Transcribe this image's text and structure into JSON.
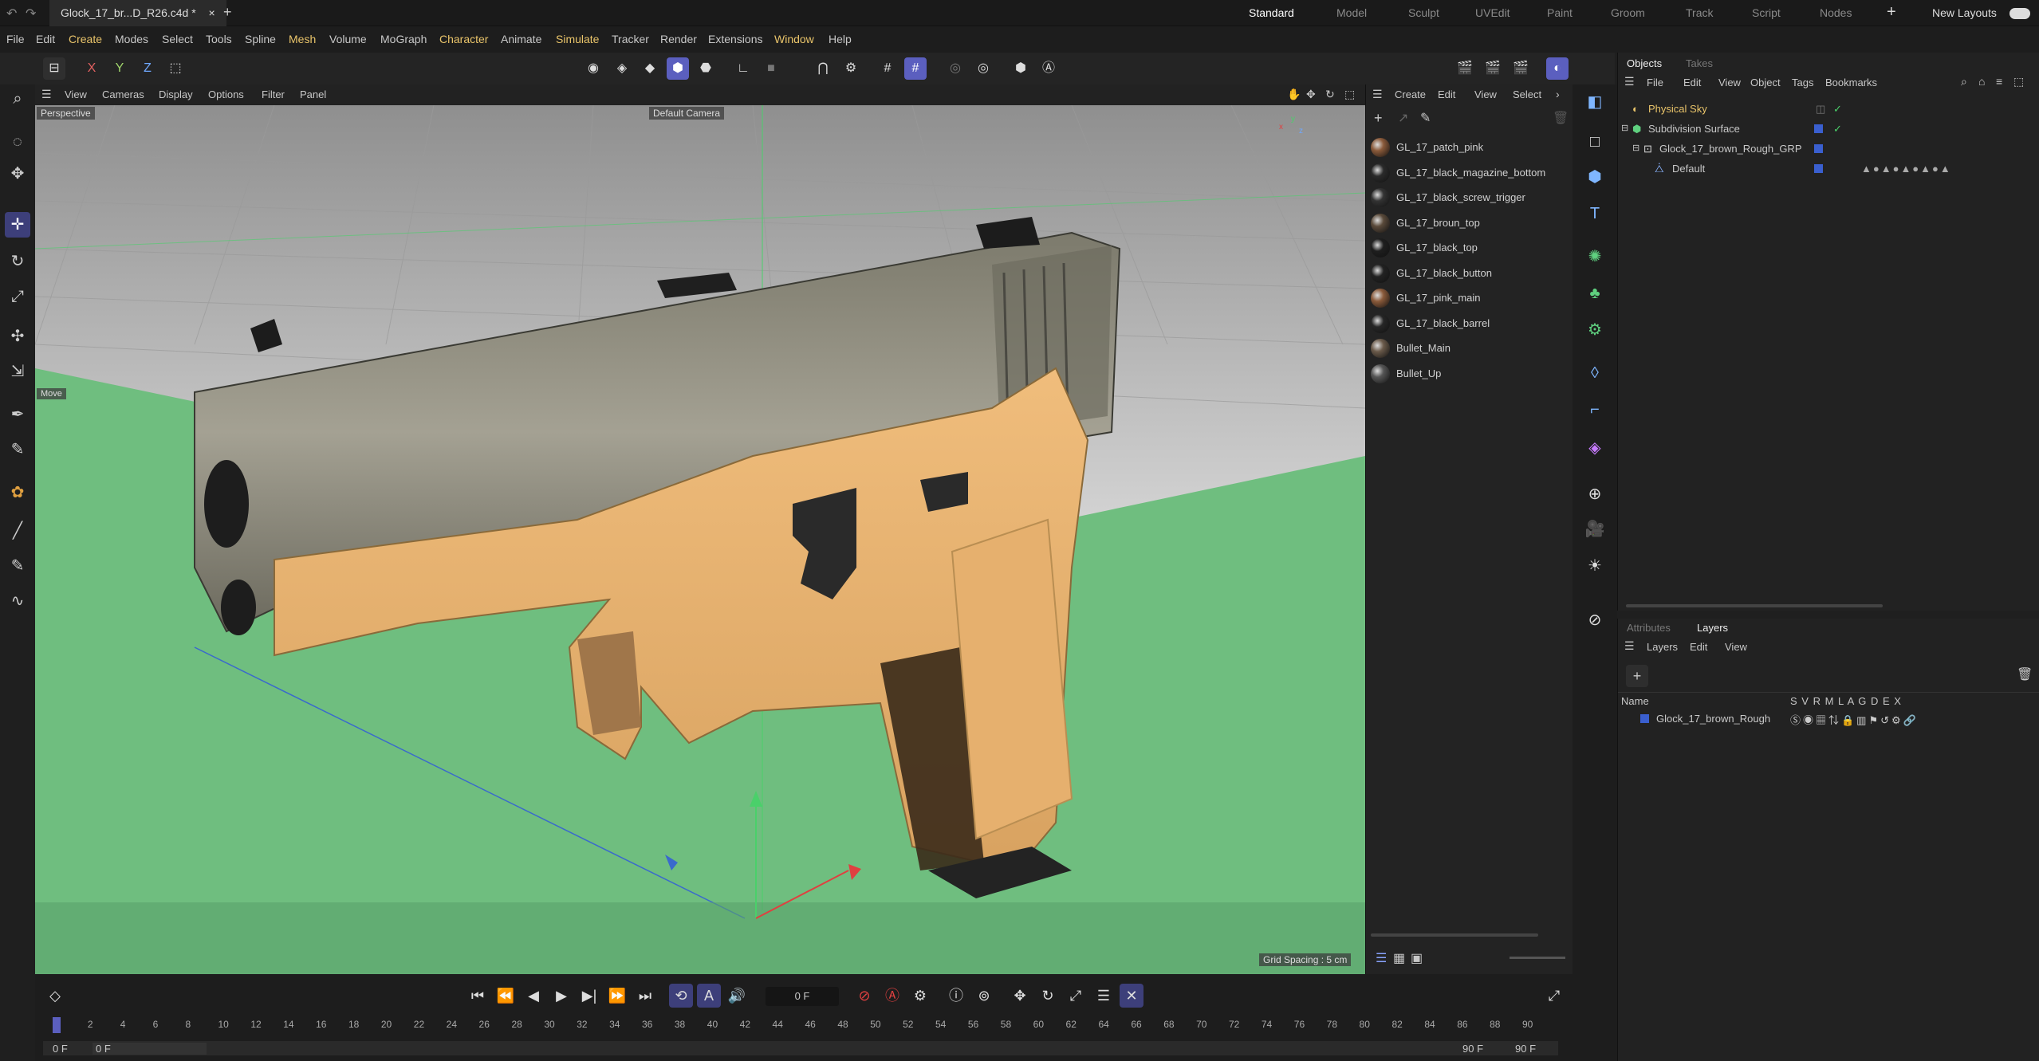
{
  "title": {
    "doc_tab": "Glock_17_br...D_R26.c4d *",
    "close": "×",
    "add": "+",
    "layouts": [
      "Standard",
      "Model",
      "Sculpt",
      "UVEdit",
      "Paint",
      "Groom",
      "Track",
      "Script",
      "Nodes"
    ],
    "new_layouts": "New Layouts"
  },
  "menu": [
    "File",
    "Edit",
    "Create",
    "Modes",
    "Select",
    "Tools",
    "Spline",
    "Mesh",
    "Volume",
    "MoGraph",
    "Character",
    "Animate",
    "Simulate",
    "Tracker",
    "Render",
    "Extensions",
    "Window",
    "Help"
  ],
  "toolbar": {
    "x": "X",
    "y": "Y",
    "z": "Z"
  },
  "viewport": {
    "menu": [
      "View",
      "Cameras",
      "Display",
      "Options",
      "Filter",
      "Panel"
    ],
    "perspective": "Perspective",
    "camera": "Default Camera",
    "move_label": "Move",
    "grid_spacing": "Grid Spacing : 5 cm"
  },
  "materials": {
    "menu": [
      "Create",
      "Edit",
      "View",
      "Select"
    ],
    "items": [
      {
        "name": "GL_17_patch_pink",
        "color": "#8a5a3a"
      },
      {
        "name": "GL_17_black_magazine_bottom",
        "color": "#2a2a2a"
      },
      {
        "name": "GL_17_black_screw_trigger",
        "color": "#333333"
      },
      {
        "name": "GL_17_broun_top",
        "color": "#5a4a3a"
      },
      {
        "name": "GL_17_black_top",
        "color": "#1e1e1e"
      },
      {
        "name": "GL_17_black_button",
        "color": "#222222"
      },
      {
        "name": "GL_17_pink_main",
        "color": "#8a5a3a"
      },
      {
        "name": "GL_17_black_barrel",
        "color": "#262626"
      },
      {
        "name": "Bullet_Main",
        "color": "#6a5a4a"
      },
      {
        "name": "Bullet_Up",
        "color": "#555555"
      }
    ]
  },
  "objects": {
    "tabs": [
      "Objects",
      "Takes"
    ],
    "menu": [
      "File",
      "Edit",
      "View",
      "Object",
      "Tags",
      "Bookmarks"
    ],
    "items": [
      {
        "name": "Physical Sky",
        "color": "#e9c46a"
      },
      {
        "name": "Subdivision Surface",
        "color": "#c8c8c8"
      },
      {
        "name": "Glock_17_brown_Rough_GRP",
        "color": "#c8c8c8"
      },
      {
        "name": "Default",
        "color": "#c8c8c8"
      }
    ]
  },
  "layers": {
    "tabs": [
      "Attributes",
      "Layers"
    ],
    "menu": [
      "Layers",
      "Edit",
      "View"
    ],
    "name_header": "Name",
    "flags_header": "S V R M L A G D E X",
    "item": "Glock_17_brown_Rough"
  },
  "timeline": {
    "frame_field": "0 F",
    "ticks": [
      "0",
      "2",
      "4",
      "6",
      "8",
      "10",
      "12",
      "14",
      "16",
      "18",
      "20",
      "22",
      "24",
      "26",
      "28",
      "30",
      "32",
      "34",
      "36",
      "38",
      "40",
      "42",
      "44",
      "46",
      "48",
      "50",
      "52",
      "54",
      "56",
      "58",
      "60",
      "62",
      "64",
      "66",
      "68",
      "70",
      "72",
      "74",
      "76",
      "78",
      "80",
      "82",
      "84",
      "86",
      "88",
      "90"
    ],
    "start_a": "0 F",
    "start_b": "0 F",
    "end_a": "90 F",
    "end_b": "90 F"
  }
}
